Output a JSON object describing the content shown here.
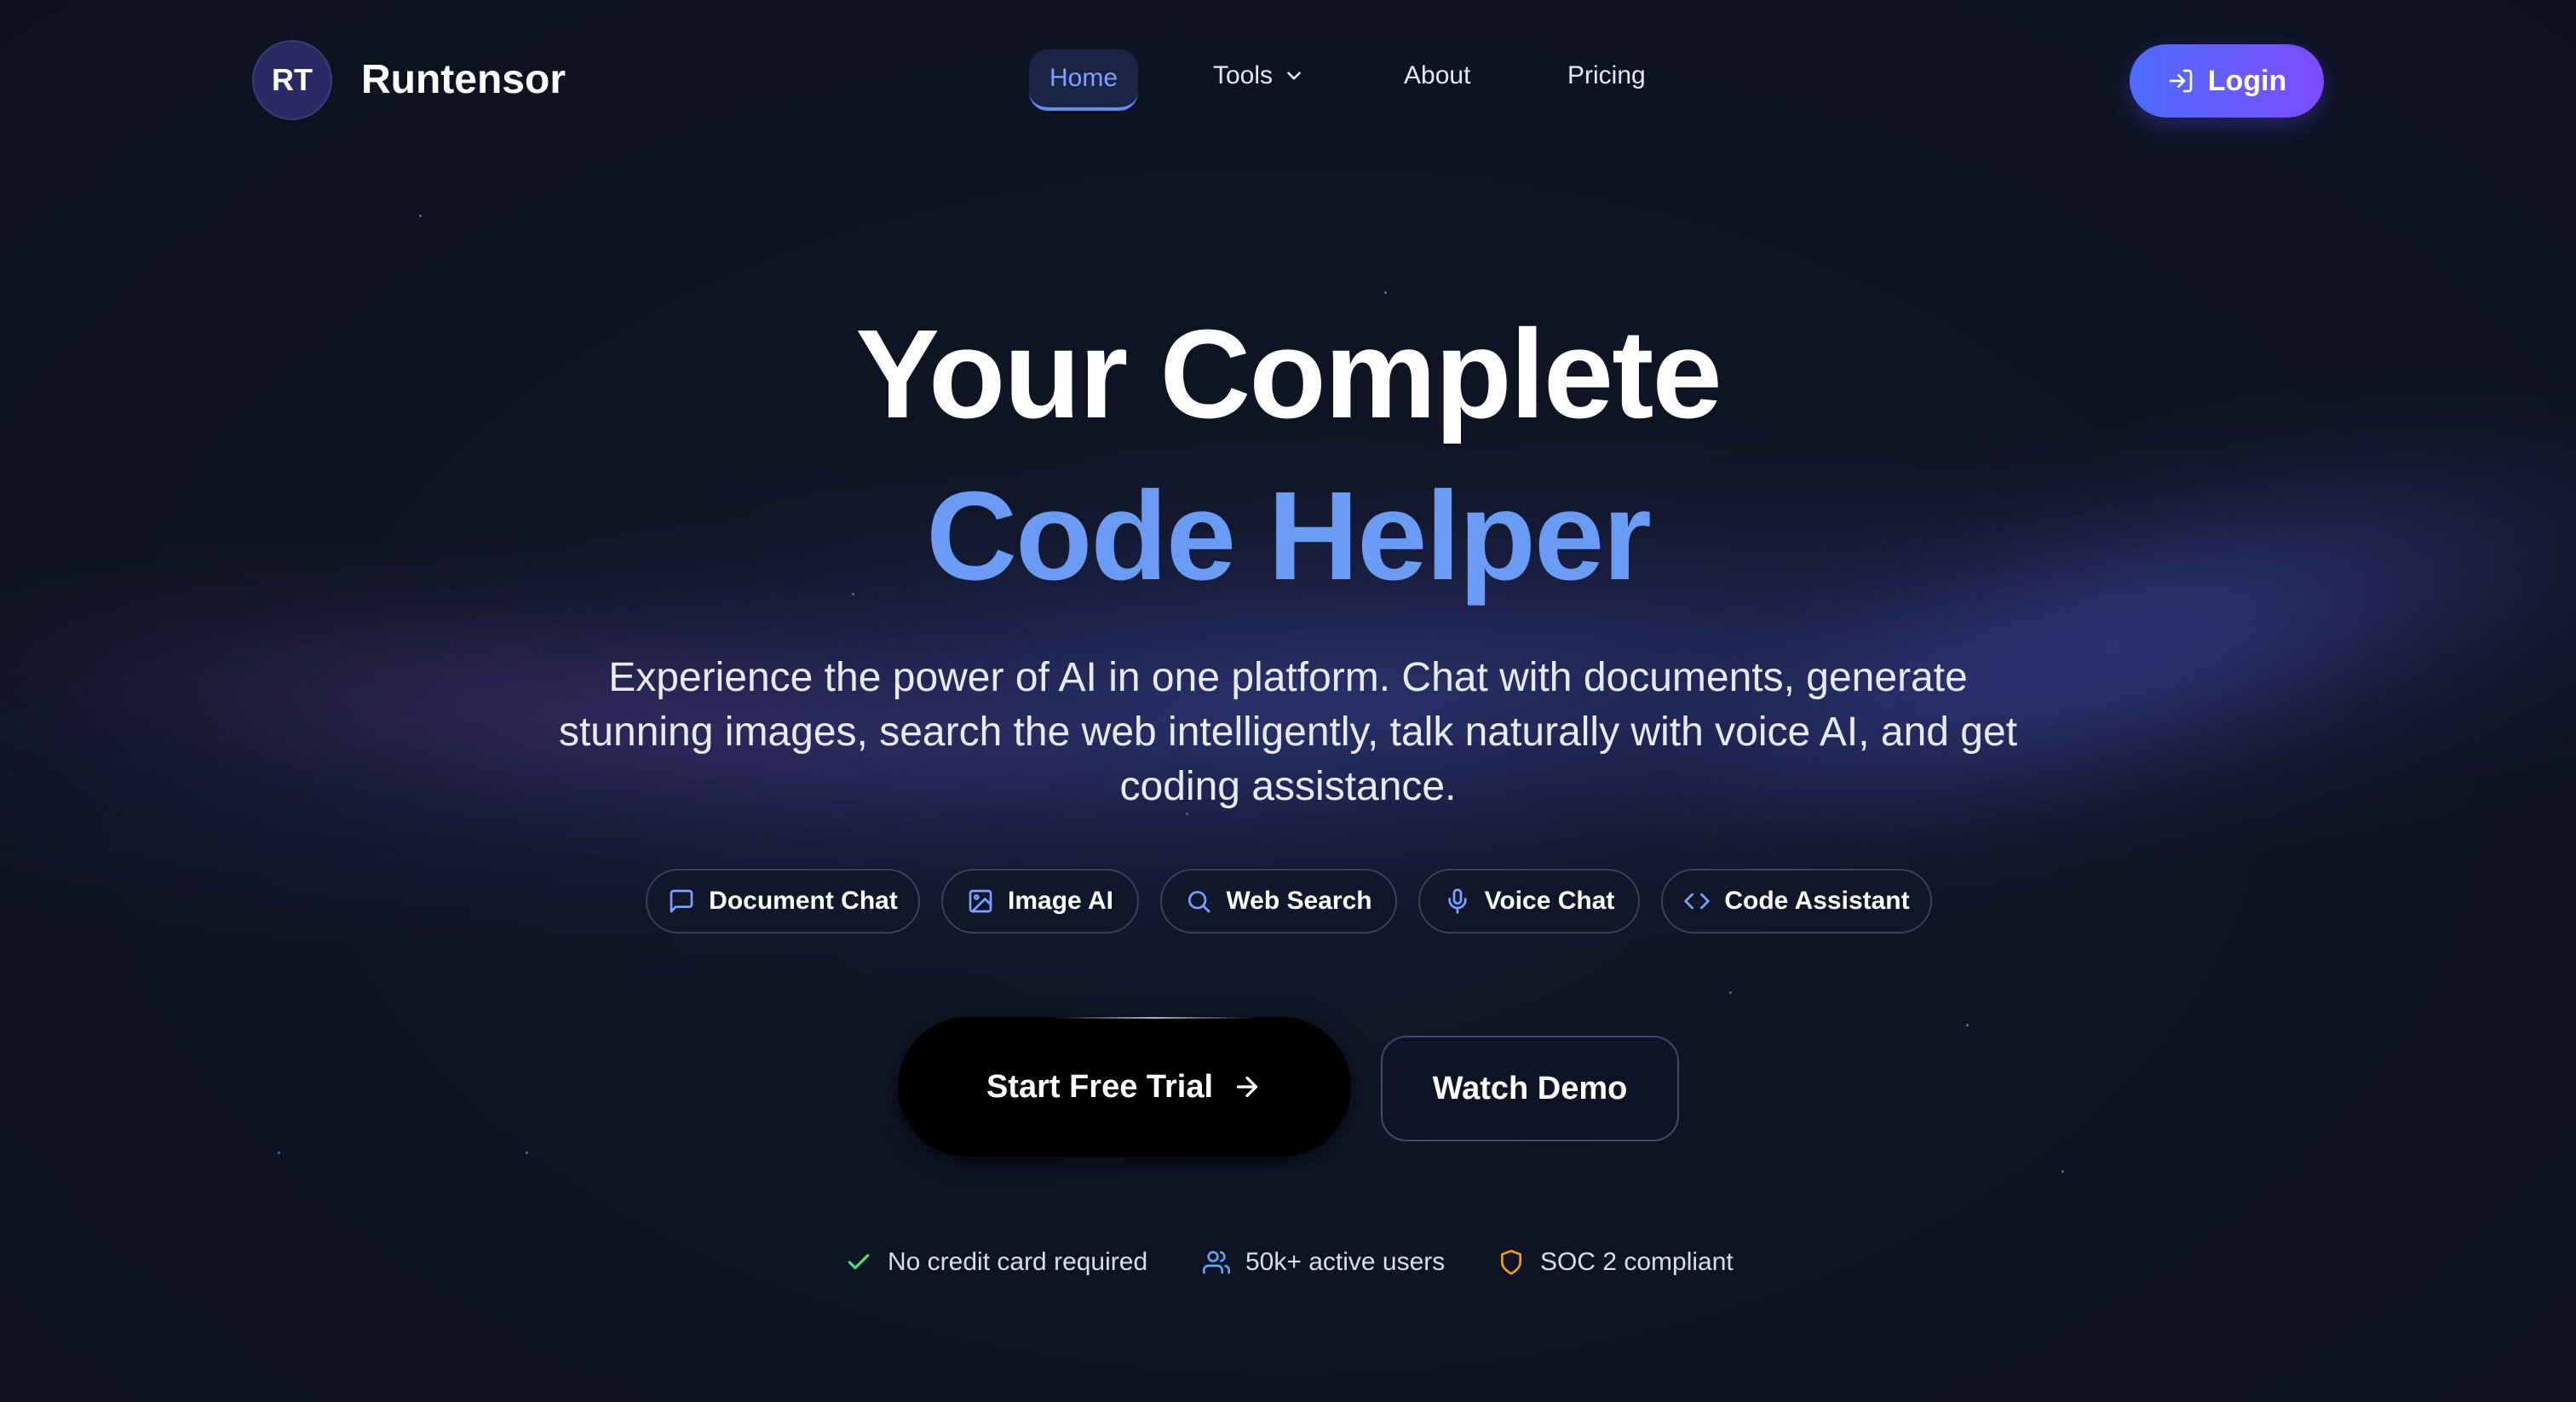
{
  "colors": {
    "background": "#111729",
    "accent_blue": "#6a9cf5",
    "nav_active": "#7aa2ff",
    "login_gradient_start": "#4d6bff",
    "login_gradient_end": "#7c4dff",
    "check_green": "#4ade80",
    "users_blue": "#60a5fa",
    "shield_amber": "#f59e0b"
  },
  "header": {
    "logo_initials": "RT",
    "brand_name": "Runtensor",
    "nav": [
      {
        "label": "Home",
        "active": true
      },
      {
        "label": "Tools",
        "icon": "chevron-down-icon"
      },
      {
        "label": "About"
      },
      {
        "label": "Pricing"
      }
    ],
    "login": {
      "label": "Login",
      "icon": "login-icon"
    }
  },
  "hero": {
    "title_line1": "Your Complete",
    "title_line2": "Code Helper",
    "subtitle": "Experience the power of AI in one platform. Chat with documents, generate stunning images, search the web intelligently, talk naturally with voice AI, and get coding assistance."
  },
  "features": [
    {
      "label": "Document Chat",
      "icon": "message-square-icon"
    },
    {
      "label": "Image AI",
      "icon": "image-icon"
    },
    {
      "label": "Web Search",
      "icon": "search-icon"
    },
    {
      "label": "Voice Chat",
      "icon": "microphone-icon"
    },
    {
      "label": "Code Assistant",
      "icon": "code-icon"
    }
  ],
  "cta": {
    "primary": {
      "label": "Start Free Trial",
      "icon": "arrow-right-icon"
    },
    "secondary": {
      "label": "Watch Demo"
    }
  },
  "trust": [
    {
      "label": "No credit card required",
      "icon": "check-icon"
    },
    {
      "label": "50k+ active users",
      "icon": "users-icon"
    },
    {
      "label": "SOC 2 compliant",
      "icon": "shield-icon"
    }
  ]
}
